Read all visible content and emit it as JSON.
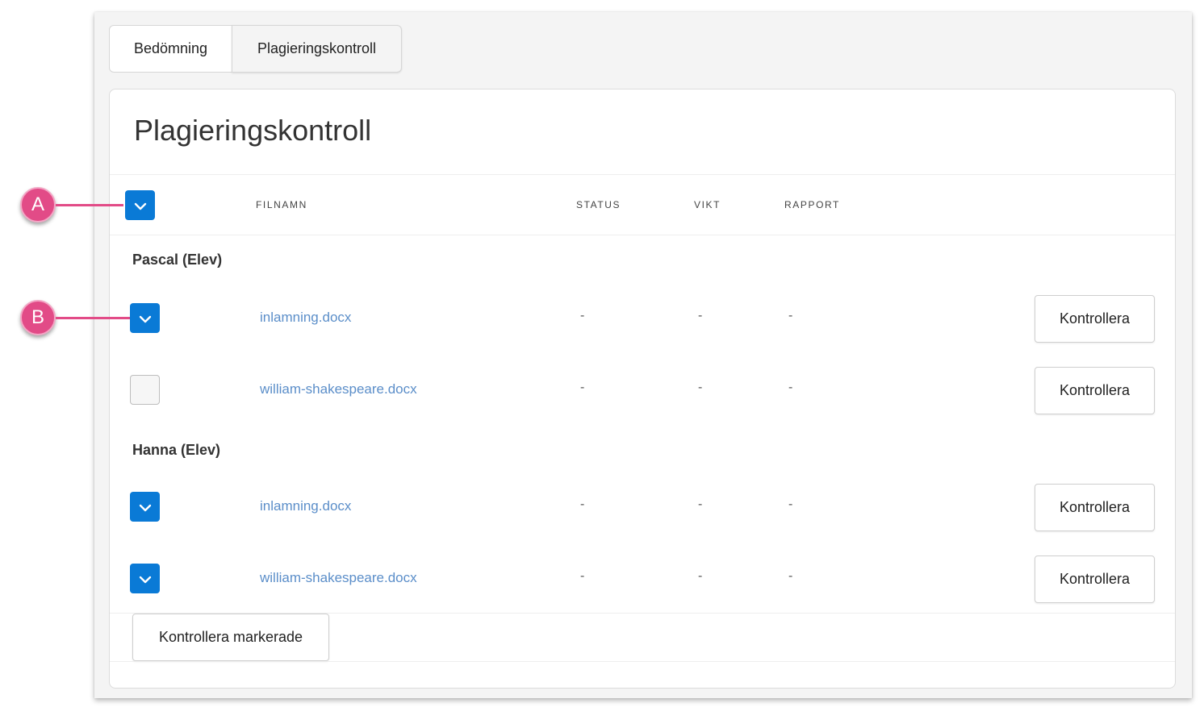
{
  "tabs": [
    {
      "label": "Bedömning",
      "active": true
    },
    {
      "label": "Plagieringskontroll",
      "active": false
    }
  ],
  "card": {
    "title": "Plagieringskontroll"
  },
  "table": {
    "headers": {
      "filename": "FILNAMN",
      "status": "STATUS",
      "weight": "VIKT",
      "report": "RAPPORT"
    },
    "select_all_checked": true,
    "groups": [
      {
        "label": "Pascal (Elev)",
        "rows": [
          {
            "checked": true,
            "filename": "inlamning.docx",
            "status": "-",
            "weight": "-",
            "report": "-",
            "action": "Kontrollera"
          },
          {
            "checked": false,
            "filename": "william-shakespeare.docx",
            "status": "-",
            "weight": "-",
            "report": "-",
            "action": "Kontrollera"
          }
        ]
      },
      {
        "label": "Hanna (Elev)",
        "rows": [
          {
            "checked": true,
            "filename": "inlamning.docx",
            "status": "-",
            "weight": "-",
            "report": "-",
            "action": "Kontrollera"
          },
          {
            "checked": true,
            "filename": "william-shakespeare.docx",
            "status": "-",
            "weight": "-",
            "report": "-",
            "action": "Kontrollera"
          }
        ]
      }
    ]
  },
  "bulk_action": {
    "label": "Kontrollera markerade"
  },
  "callouts": {
    "a": "A",
    "b": "B"
  },
  "colors": {
    "checkbox": "#0a7ad6",
    "callout": "#e24b87",
    "link": "#5b8ec9"
  }
}
